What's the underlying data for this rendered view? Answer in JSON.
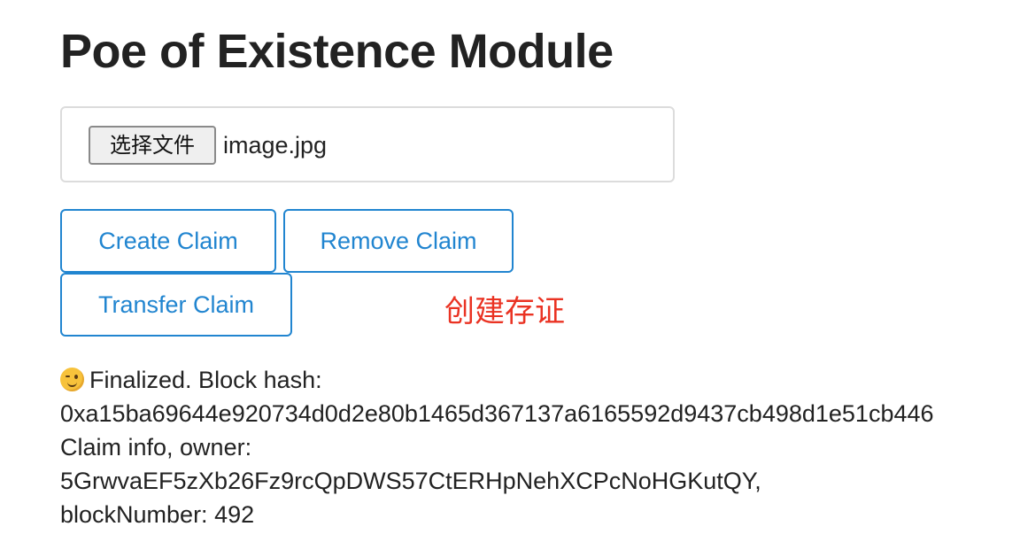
{
  "page": {
    "title": "Poe of Existence Module"
  },
  "file_input": {
    "button_label": "选择文件",
    "file_name": "image.jpg"
  },
  "actions": {
    "create_label": "Create Claim",
    "remove_label": "Remove Claim",
    "transfer_label": "Transfer Claim"
  },
  "annotation": {
    "text": "创建存证",
    "color": "#ea3323"
  },
  "status": {
    "icon": "winking-face-icon",
    "line1": "Finalized. Block hash:",
    "line2": "0xa15ba69644e920734d0d2e80b1465d367137a6165592d9437cb498d1e51cb446",
    "line3": "Claim info, owner:",
    "line4": "5GrwvaEF5zXb26Fz9rcQpDWS57CtERHpNehXCPcNoHGKutQY,",
    "line5": "blockNumber: 492"
  },
  "colors": {
    "accent": "#2185d0",
    "text": "#222222",
    "border": "#dcdcdc"
  }
}
